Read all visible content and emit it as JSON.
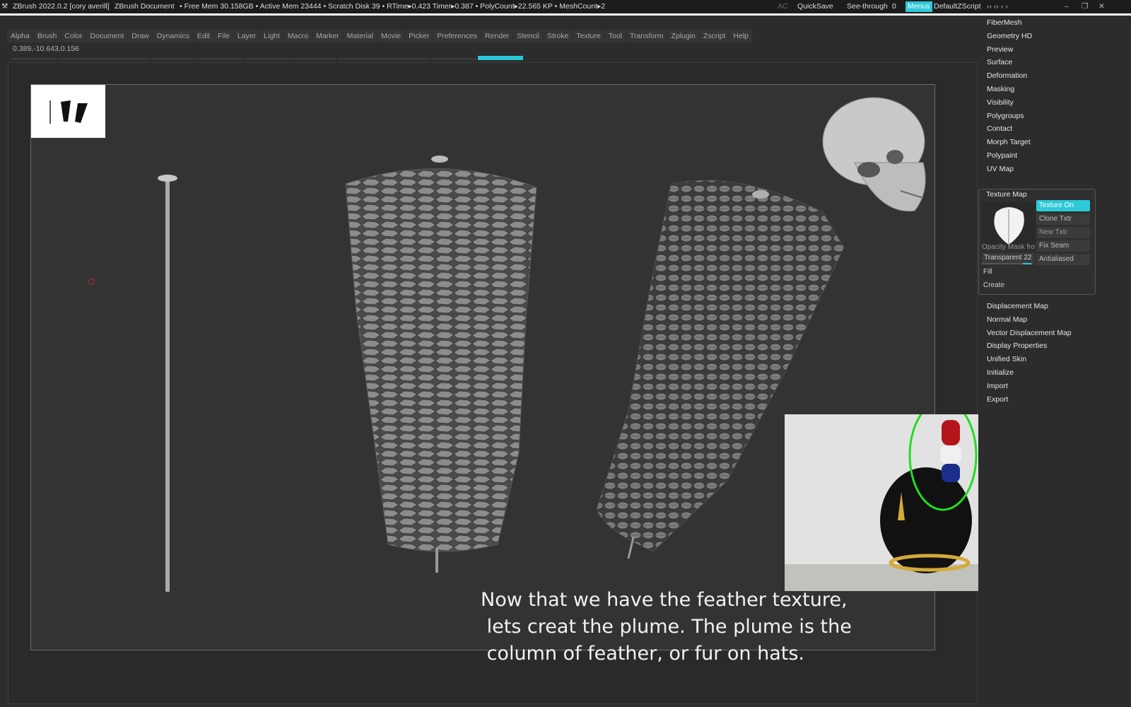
{
  "titlebar": {
    "app_title": "ZBrush 2022.0.2 [cory averill]",
    "document": "ZBrush Document",
    "stats": "• Free Mem 30.158GB • Active Mem 23444 • Scratch Disk 39 •  RTime▸0.423 Timer▸0.387 • PolyCount▸22.565 KP  • MeshCount▸2",
    "ac": "AC",
    "quicksave": "QuickSave",
    "seethrough": "See-through",
    "seethrough_value": "0",
    "menus": "Menus",
    "script": "DefaultZScript"
  },
  "menubar": [
    "Alpha",
    "Brush",
    "Color",
    "Document",
    "Draw",
    "Dynamics",
    "Edit",
    "File",
    "Layer",
    "Light",
    "Macro",
    "Marker",
    "Material",
    "Movie",
    "Picker",
    "Preferences",
    "Render",
    "Stencil",
    "Stroke",
    "Texture",
    "Tool",
    "Transform",
    "Zplugin",
    "Zscript",
    "Help"
  ],
  "coords": "0.389,-10.643,0.156",
  "sidebar": {
    "items_top": [
      "FiberMesh",
      "Geometry HD",
      "Preview",
      "Surface",
      "Deformation",
      "Masking",
      "Visibility",
      "Polygroups",
      "Contact",
      "Morph Target",
      "Polypaint",
      "UV Map"
    ],
    "texture_map": {
      "title": "Texture Map",
      "texture_on": "Texture On",
      "clone": "Clone Txtr",
      "new": "New Txtr",
      "fix_seam": "Fix Seam",
      "antialiased": "Antialiased",
      "opacity_label": "Opacity Mask fro",
      "transparent_label": "Transparent 22",
      "fill": "Fill",
      "create": "Create"
    },
    "items_bottom": [
      "Displacement Map",
      "Normal Map",
      "Vector Displacement Map",
      "Display Properties",
      "Unified Skin",
      "Initialize",
      "Import",
      "Export"
    ]
  },
  "caption": "Now that we have the feather texture,\n lets creat the plume. The plume is the\n column of feather, or fur on hats.",
  "colors": {
    "accent": "#2ec9d8",
    "highlight_circle": "#22dd22"
  }
}
